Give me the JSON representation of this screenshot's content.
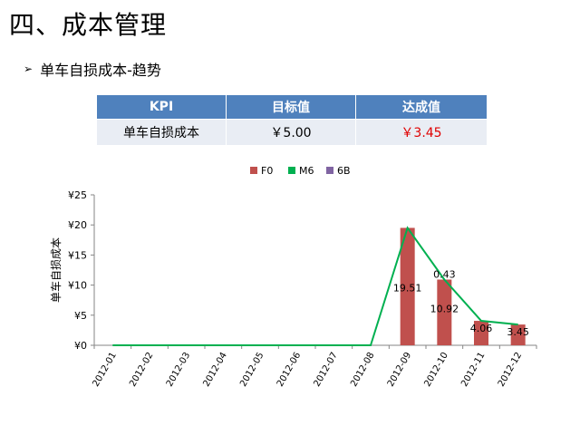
{
  "page": {
    "title": "四、成本管理",
    "subtitle": "单车自损成本-趋势",
    "bullet_icon": "arrow-bullet-icon"
  },
  "kpi_table": {
    "headers": [
      "KPI",
      "目标值",
      "达成值"
    ],
    "row": [
      "单车自损成本",
      "￥5.00",
      "￥3.45"
    ],
    "header_color": "#4f81bd",
    "row_color": "#e9edf4",
    "highlight_color": "#e00000"
  },
  "chart_data": {
    "type": "bar",
    "categories": [
      "2012-01",
      "2012-02",
      "2012-03",
      "2012-04",
      "2012-05",
      "2012-06",
      "2012-07",
      "2012-08",
      "2012-09",
      "2012-10",
      "2012-11",
      "2012-12"
    ],
    "series": [
      {
        "name": "F0",
        "type": "bar",
        "color": "#c0504d",
        "values": [
          0,
          0,
          0,
          0,
          0,
          0,
          0,
          0,
          19.51,
          10.92,
          4.06,
          3.45
        ]
      },
      {
        "name": "M6",
        "type": "line",
        "color": "#00b050",
        "values": [
          0,
          0,
          0,
          0,
          0,
          0,
          0,
          0,
          19.51,
          10.92,
          4.06,
          3.45
        ]
      },
      {
        "name": "6B",
        "type": "bar",
        "color": "#8064a2",
        "values": [
          0,
          0,
          0,
          0,
          0,
          0,
          0,
          0,
          0,
          0,
          0,
          0
        ]
      }
    ],
    "data_labels": [
      {
        "category": "2012-09",
        "text": "19.51"
      },
      {
        "category": "2012-10",
        "text": "10.92"
      },
      {
        "category": "2012-10",
        "text": "0.43"
      },
      {
        "category": "2012-11",
        "text": "4.06"
      },
      {
        "category": "2012-12",
        "text": "3.45"
      }
    ],
    "ylabel": "单车自损成本",
    "xlabel": "",
    "yticks": [
      "¥0",
      "¥5",
      "¥10",
      "¥15",
      "¥20",
      "¥25"
    ],
    "ylim": [
      0,
      25
    ],
    "legend_position": "top",
    "grid": true
  }
}
